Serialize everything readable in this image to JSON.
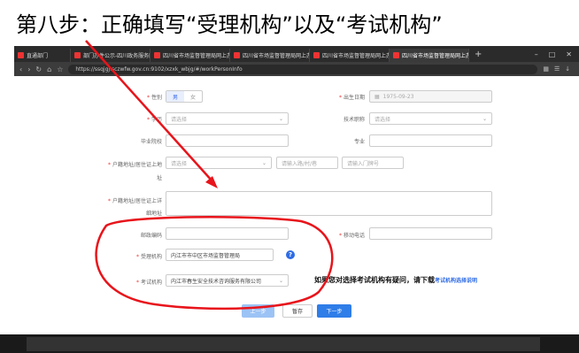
{
  "heading": "第八步：正确填写“受理机构”以及“考试机构”",
  "browser": {
    "tabs": [
      {
        "label": "直通部门"
      },
      {
        "label": "部门办件公示-四川政务服务网"
      },
      {
        "label": "四川省市场监督管理局网上办"
      },
      {
        "label": "四川省市场监督管理局网上办"
      },
      {
        "label": "四川省市场监督管理局网上办"
      },
      {
        "label": "四川省市场监督管理局网上办"
      }
    ],
    "new_tab": "+",
    "url": "https://ssqjgj.sczwfw.gov.cn:9102/xzxk_wbjg/#/workPersonInfo"
  },
  "form": {
    "gender_label": "性别",
    "gender_male": "男",
    "gender_female": "女",
    "birth_label": "出生日期",
    "birth_value": "1975-09-23",
    "education_label": "学历",
    "education_placeholder": "请选择",
    "title_label": "技术职称",
    "title_placeholder": "请选择",
    "school_label": "毕业院校",
    "major_label": "专业",
    "address_label_1": "户籍地址/居住证上地",
    "address_label_2": "址",
    "address_select_placeholder": "请选择",
    "address_road_placeholder": "请输入路/村/巷",
    "address_door_placeholder": "请输入门牌号",
    "detail_label_1": "户籍地址/居住证上详",
    "detail_label_2": "细地址",
    "postcode_label": "邮政编码",
    "mobile_label": "移动电话",
    "accept_org_label": "受理机构",
    "accept_org_value": "内江市市中区市场监督管理局",
    "exam_org_label": "考试机构",
    "exam_org_value": "内江市春生安全技术咨询服务有限公司",
    "notice_text": "如果您对选择考试机构有疑问，请下载",
    "notice_link": "考试机构选择说明"
  },
  "buttons": {
    "prev": "上一步",
    "save": "暂存",
    "next": "下一步"
  },
  "colors": {
    "annotation_red": "#e8141b",
    "primary_blue": "#2f7de8"
  }
}
